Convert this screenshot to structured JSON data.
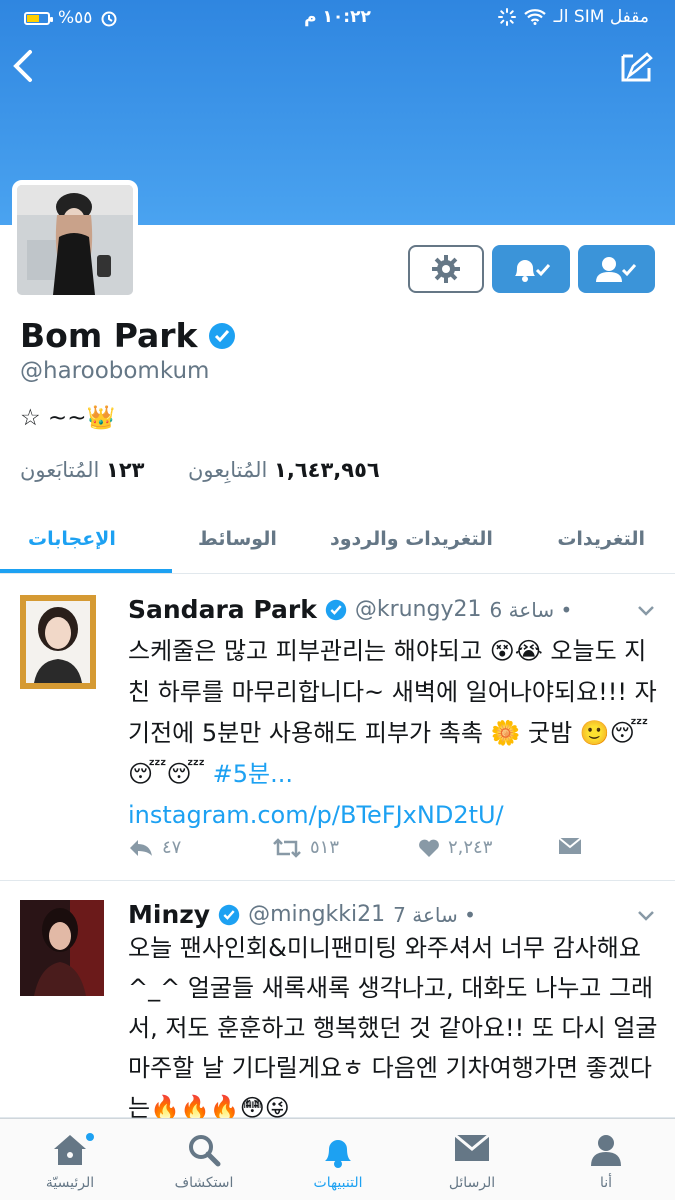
{
  "status_bar": {
    "battery": "%٥٥",
    "time": "١٠:٢٢ م",
    "carrier": "الـ SIM مقفل"
  },
  "profile": {
    "name": "Bom Park",
    "handle": "@haroobomkum",
    "bio": "☆ ~~👑",
    "followers_count": "١,٦٤٣,٩٥٦",
    "followers_label": "المُتابِعون",
    "following_count": "١٢٣",
    "following_label": "المُتابَعون"
  },
  "tabs": [
    {
      "label": "التغريدات"
    },
    {
      "label": "التغريدات والردود"
    },
    {
      "label": "الوسائط"
    },
    {
      "label": "الإعجابات"
    }
  ],
  "tweets": [
    {
      "name": "Sandara Park",
      "handle": "@krungy21",
      "time": "6 ساعة •",
      "text": "스케줄은 많고 피부관리는 해야되고 😵😭 오늘도 지친 하루를 마무리합니다~ 새벽에 일어나야되요!!! 자기전에 5분만 사용해도 피부가 촉촉 🌼 굿밤 🙂😴😴😴 ",
      "hashtag": "#5분...",
      "link": "instagram.com/p/BTeFJxND2tU/",
      "replies": "٤٧",
      "retweets": "٥١٣",
      "likes": "٢,٢٤٣"
    },
    {
      "name": "Minzy",
      "handle": "@mingkki21",
      "time": "7 ساعة •",
      "text": "오늘 팬사인회&미니팬미팅 와주셔서 너무 감사해요^_^ 얼굴들 새록새록 생각나고, 대화도 나누고 그래서, 저도 훈훈하고 행복했던 것 같아요!! 또 다시 얼굴 마주할 날 기다릴게요ㅎ 다음엔 기차여행가면 좋겠다는🔥🔥🔥😳😜"
    }
  ],
  "tabbar": [
    {
      "label": "الرئيسيّة",
      "icon": "home-icon"
    },
    {
      "label": "استكشاف",
      "icon": "search-icon"
    },
    {
      "label": "التنبيهات",
      "icon": "bell-icon"
    },
    {
      "label": "الرسائل",
      "icon": "mail-icon"
    },
    {
      "label": "أنا",
      "icon": "person-icon"
    }
  ],
  "colors": {
    "accent": "#1da1f2",
    "banner": "#3d95e6"
  }
}
